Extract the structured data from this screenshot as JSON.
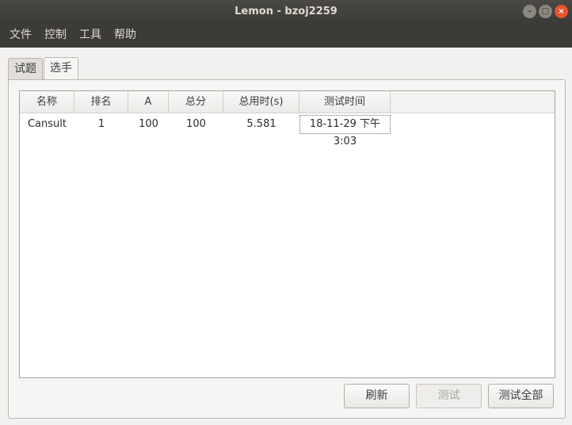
{
  "window": {
    "title": "Lemon - bzoj2259"
  },
  "menu": {
    "items": [
      "文件",
      "控制",
      "工具",
      "帮助"
    ]
  },
  "tabs": [
    {
      "label": "试题",
      "active": false
    },
    {
      "label": "选手",
      "active": true
    }
  ],
  "table": {
    "columns": [
      "名称",
      "排名",
      "A",
      "总分",
      "总用时(s)",
      "测试时间"
    ],
    "rows": [
      [
        "Cansult",
        "1",
        "100",
        "100",
        "5.581",
        "18-11-29 下午3:03"
      ]
    ]
  },
  "buttons": {
    "refresh": "刷新",
    "test": "测试",
    "test_all": "测试全部"
  },
  "icons": {
    "minimize": "minimize-icon",
    "maximize": "maximize-icon",
    "close": "close-icon"
  },
  "colors": {
    "titlebar": "#3c3b37",
    "close_button": "#e9542c",
    "window_bg": "#f2f1f0"
  }
}
